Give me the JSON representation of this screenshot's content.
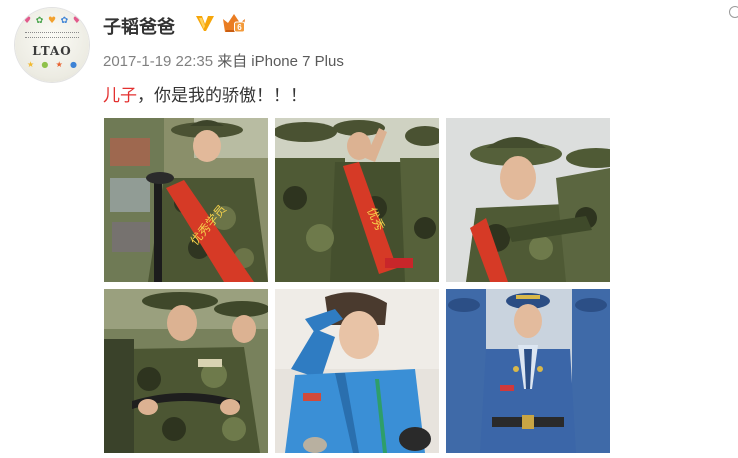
{
  "post": {
    "username": "子韬爸爸",
    "avatar_text": "LTAO",
    "timestamp": "2017-1-19 22:35",
    "source_prefix": "来自",
    "source_device": "iPhone 7 Plus",
    "text_topic": "儿子",
    "text_rest": "，你是我的骄傲！！！"
  },
  "icons": {
    "verified": "vip-verified-icon",
    "level": "member-level-icon",
    "more": "dropdown-caret-icon"
  },
  "photos": [
    {
      "scene": "soldier in camouflage with red sash",
      "sash_text": "优秀学员"
    },
    {
      "scene": "soldiers saluting with red sash",
      "sash_text": "优秀"
    },
    {
      "scene": "soldier in jungle hat receiving congratulations"
    },
    {
      "scene": "soldiers in camouflage holding equipment"
    },
    {
      "scene": "pilot in blue flight suit saluting"
    },
    {
      "scene": "air force officer in blue dress uniform"
    }
  ],
  "colors": {
    "username": "#333333",
    "meta": "#808080",
    "topic": "#e3302f",
    "verified": "#f6a60a",
    "level": "#ea7d22"
  }
}
